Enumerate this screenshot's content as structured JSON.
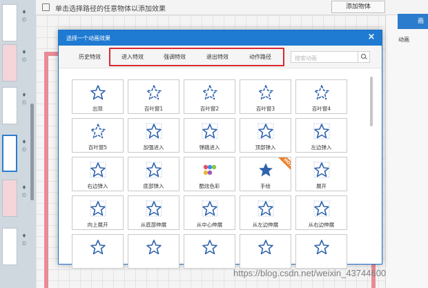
{
  "editor": {
    "top_hint": "单击选择路径的任意物体以添加效果",
    "add_object_button": "添加物体",
    "right_tab_label": "画",
    "right_panel_label": "动画"
  },
  "dialog": {
    "title": "选择一个动画效果",
    "close_icon": "close-icon",
    "tabs": [
      {
        "label": "历史特效"
      },
      {
        "label": "进入特效"
      },
      {
        "label": "强调特效"
      },
      {
        "label": "退出特效"
      },
      {
        "label": "动作路径"
      }
    ],
    "search": {
      "placeholder": "搜索动画"
    },
    "effects": [
      {
        "label": "出现",
        "icon": "star-icon"
      },
      {
        "label": "百叶窗1",
        "icon": "star-blinds-icon"
      },
      {
        "label": "百叶窗2",
        "icon": "star-blinds-icon"
      },
      {
        "label": "百叶窗3",
        "icon": "star-blinds-icon"
      },
      {
        "label": "百叶窗4",
        "icon": "star-blinds-icon"
      },
      {
        "label": "百叶窗5",
        "icon": "star-blinds-icon"
      },
      {
        "label": "加强进入",
        "icon": "star-arrow-icon"
      },
      {
        "label": "弹跳进入",
        "icon": "star-arrow-icon"
      },
      {
        "label": "顶部弹入",
        "icon": "star-arrow-icon"
      },
      {
        "label": "左边弹入",
        "icon": "star-arrow-icon"
      },
      {
        "label": "右边弹入",
        "icon": "star-arrow-icon"
      },
      {
        "label": "底部弹入",
        "icon": "star-arrow-icon"
      },
      {
        "label": "酷炫色彩",
        "icon": "color-palette-icon"
      },
      {
        "label": "手绘",
        "icon": "hand-draw-icon",
        "badge": "HOT"
      },
      {
        "label": "展开",
        "icon": "star-expand-icon"
      },
      {
        "label": "向上展开",
        "icon": "star-expand-icon"
      },
      {
        "label": "从底部伸展",
        "icon": "star-expand-icon"
      },
      {
        "label": "从中心伸展",
        "icon": "star-expand-icon"
      },
      {
        "label": "从左边伸展",
        "icon": "star-expand-icon"
      },
      {
        "label": "从右边伸展",
        "icon": "star-expand-icon"
      },
      {
        "label": "",
        "icon": "star-icon"
      },
      {
        "label": "",
        "icon": "star-icon"
      },
      {
        "label": "",
        "icon": "star-icon"
      },
      {
        "label": "",
        "icon": "star-icon"
      },
      {
        "label": "",
        "icon": "star-icon"
      }
    ]
  },
  "watermark": "https://blog.csdn.net/weixin_43744600",
  "colors": {
    "accent": "#1f7ad2",
    "highlight": "#d9262e",
    "star": "#2f63ad",
    "hot": "#ef7f2a"
  }
}
